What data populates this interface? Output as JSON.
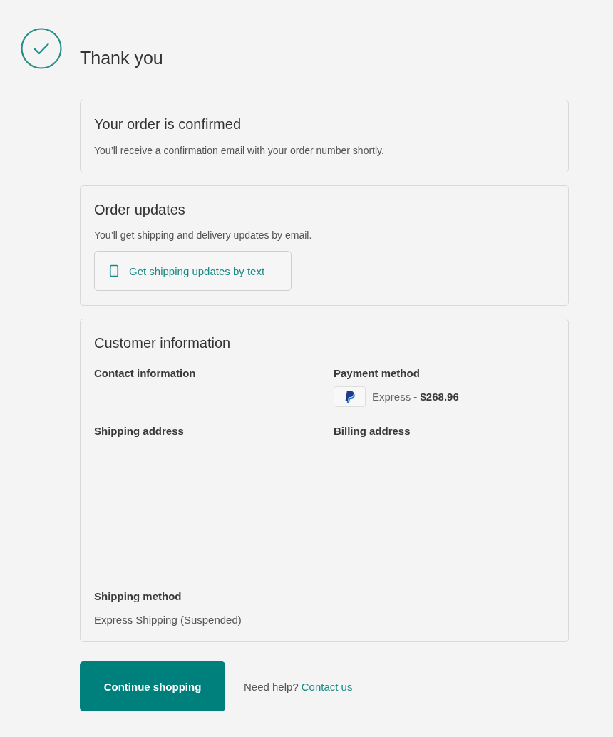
{
  "header": {
    "title": "Thank you"
  },
  "confirmation": {
    "title": "Your order is confirmed",
    "text": "You’ll receive a confirmation email with your order number shortly."
  },
  "order_updates": {
    "title": "Order updates",
    "text": "You’ll get shipping and delivery updates by email.",
    "button": "Get shipping updates by text"
  },
  "customer_information": {
    "title": "Customer information",
    "contact_information": {
      "label": "Contact information"
    },
    "payment_method": {
      "label": "Payment method",
      "detail": "Express **- $268.96**"
    },
    "shipping_address": {
      "label": "Shipping address"
    },
    "billing_address": {
      "label": "Billing address"
    },
    "shipping_method": {
      "label": "Shipping method",
      "value": "Express Shipping (Suspended)"
    }
  },
  "footer": {
    "button": "Continue shopping",
    "help_text": "Need help?",
    "link": "Contact us"
  }
}
